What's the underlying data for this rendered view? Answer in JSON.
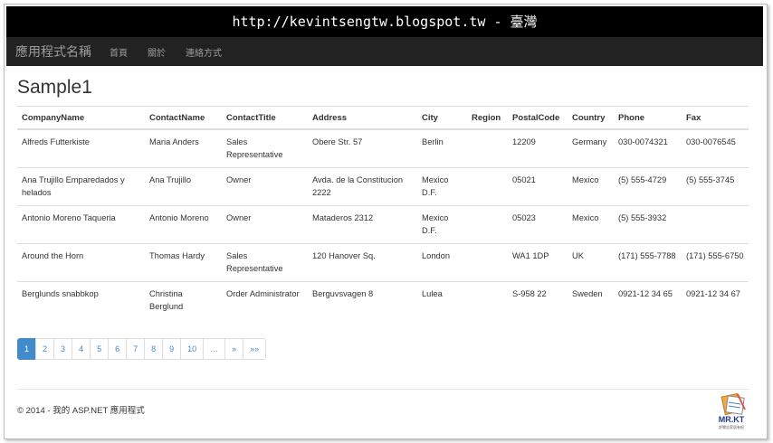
{
  "banner": {
    "text": "http://kevintsengtw.blogspot.tw - 臺灣"
  },
  "navbar": {
    "brand": "應用程式名稱",
    "links": [
      "首頁",
      "關於",
      "連絡方式"
    ]
  },
  "page": {
    "title": "Sample1"
  },
  "table": {
    "headers": [
      "CompanyName",
      "ContactName",
      "ContactTitle",
      "Address",
      "City",
      "Region",
      "PostalCode",
      "Country",
      "Phone",
      "Fax"
    ],
    "rows": [
      [
        "Alfreds Futterkiste",
        "Maria Anders",
        "Sales Representative",
        "Obere Str. 57",
        "Berlin",
        "",
        "12209",
        "Germany",
        "030-0074321",
        "030-0076545"
      ],
      [
        "Ana Trujillo Emparedados y helados",
        "Ana Trujillo",
        "Owner",
        "Avda. de la Constitucion 2222",
        "Mexico D.F.",
        "",
        "05021",
        "Mexico",
        "(5) 555-4729",
        "(5) 555-3745"
      ],
      [
        "Antonio Moreno Taqueria",
        "Antonio Moreno",
        "Owner",
        "Mataderos 2312",
        "Mexico D.F.",
        "",
        "05023",
        "Mexico",
        "(5) 555-3932",
        ""
      ],
      [
        "Around the Horn",
        "Thomas Hardy",
        "Sales Representative",
        "120 Hanover Sq.",
        "London",
        "",
        "WA1 1DP",
        "UK",
        "(171) 555-7788",
        "(171) 555-6750"
      ],
      [
        "Berglunds snabbkop",
        "Christina Berglund",
        "Order Administrator",
        "Berguvsvagen 8",
        "Lulea",
        "",
        "S-958 22",
        "Sweden",
        "0921-12 34 65",
        "0921-12 34 67"
      ]
    ]
  },
  "pagination": {
    "pages": [
      "1",
      "2",
      "3",
      "4",
      "5",
      "6",
      "7",
      "8",
      "9",
      "10"
    ],
    "active": "1",
    "ellipsis": "…",
    "next": "»",
    "last": "»»"
  },
  "footer": {
    "text": "© 2014 - 我的 ASP.NET 應用程式"
  },
  "logo": {
    "name": "MR.KT",
    "tagline": "舒爾志家居有紀"
  },
  "colors": {
    "link": "#428bca",
    "navbar": "#222222",
    "banner": "#000000"
  }
}
